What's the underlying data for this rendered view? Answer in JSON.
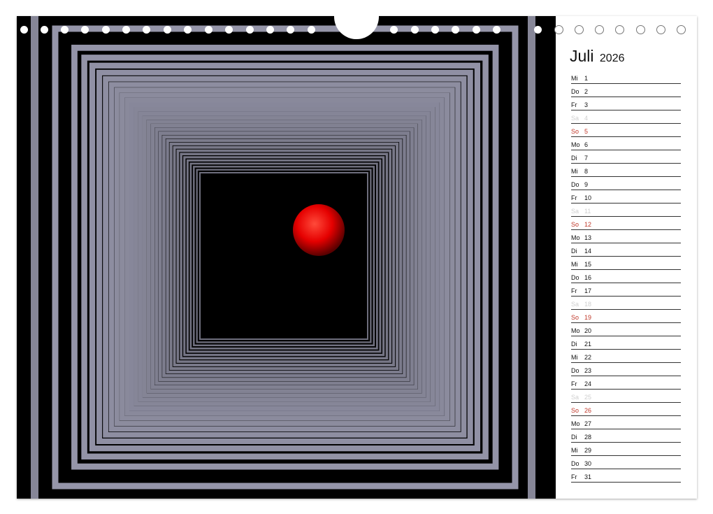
{
  "calendar": {
    "month": "Juli",
    "year": "2026",
    "days": [
      {
        "wd": "Mi",
        "d": "1",
        "t": "w"
      },
      {
        "wd": "Do",
        "d": "2",
        "t": "w"
      },
      {
        "wd": "Fr",
        "d": "3",
        "t": "w"
      },
      {
        "wd": "Sa",
        "d": "4",
        "t": "sat"
      },
      {
        "wd": "So",
        "d": "5",
        "t": "sun"
      },
      {
        "wd": "Mo",
        "d": "6",
        "t": "w"
      },
      {
        "wd": "Di",
        "d": "7",
        "t": "w"
      },
      {
        "wd": "Mi",
        "d": "8",
        "t": "w"
      },
      {
        "wd": "Do",
        "d": "9",
        "t": "w"
      },
      {
        "wd": "Fr",
        "d": "10",
        "t": "w"
      },
      {
        "wd": "Sa",
        "d": "11",
        "t": "sat"
      },
      {
        "wd": "So",
        "d": "12",
        "t": "sun"
      },
      {
        "wd": "Mo",
        "d": "13",
        "t": "w"
      },
      {
        "wd": "Di",
        "d": "14",
        "t": "w"
      },
      {
        "wd": "Mi",
        "d": "15",
        "t": "w"
      },
      {
        "wd": "Do",
        "d": "16",
        "t": "w"
      },
      {
        "wd": "Fr",
        "d": "17",
        "t": "w"
      },
      {
        "wd": "Sa",
        "d": "18",
        "t": "sat"
      },
      {
        "wd": "So",
        "d": "19",
        "t": "sun"
      },
      {
        "wd": "Mo",
        "d": "20",
        "t": "w"
      },
      {
        "wd": "Di",
        "d": "21",
        "t": "w"
      },
      {
        "wd": "Mi",
        "d": "22",
        "t": "w"
      },
      {
        "wd": "Do",
        "d": "23",
        "t": "w"
      },
      {
        "wd": "Fr",
        "d": "24",
        "t": "w"
      },
      {
        "wd": "Sa",
        "d": "25",
        "t": "sat"
      },
      {
        "wd": "So",
        "d": "26",
        "t": "sun"
      },
      {
        "wd": "Mo",
        "d": "27",
        "t": "w"
      },
      {
        "wd": "Di",
        "d": "28",
        "t": "w"
      },
      {
        "wd": "Mi",
        "d": "29",
        "t": "w"
      },
      {
        "wd": "Do",
        "d": "30",
        "t": "w"
      },
      {
        "wd": "Fr",
        "d": "31",
        "t": "w"
      }
    ]
  },
  "colors": {
    "sunday": "#c0392b",
    "saturday": "#cfcfcf",
    "frame": "#9d9db2",
    "sphere": "#e50000",
    "background": "#000000"
  },
  "artwork": {
    "subject": "nested-square-tunnel-with-red-sphere"
  }
}
